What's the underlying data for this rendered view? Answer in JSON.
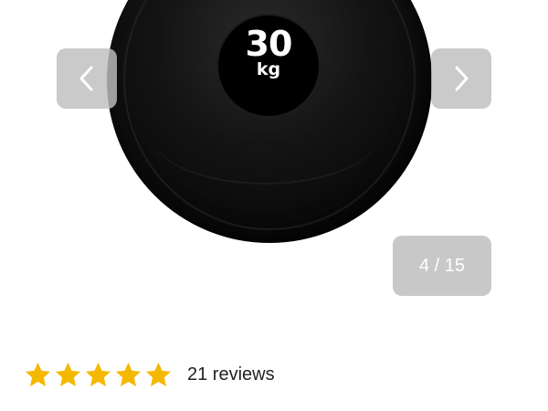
{
  "gallery": {
    "product_label": {
      "weight": "30",
      "unit": "kg"
    },
    "prev_icon": "chevron-left-icon",
    "next_icon": "chevron-right-icon",
    "counter": "4 / 15",
    "colors": {
      "button_bg": "#bebebe",
      "ball": "#0a0a0a"
    }
  },
  "rating": {
    "stars": 5,
    "max_stars": 5,
    "star_icon": "star-icon",
    "star_color": "#f5b800",
    "reviews_label": "21 reviews"
  }
}
